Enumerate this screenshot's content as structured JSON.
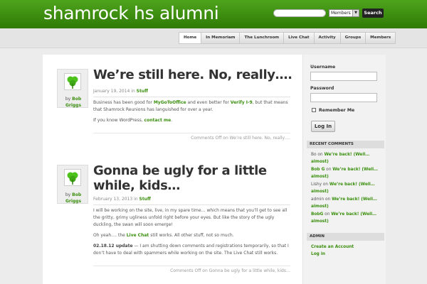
{
  "header": {
    "site_title": "shamrock hs alumni",
    "search_placeholder": "",
    "search_scope": "Members",
    "search_button": "Search"
  },
  "nav": {
    "items": [
      {
        "label": "Home",
        "active": true
      },
      {
        "label": "In Memoriam",
        "active": false
      },
      {
        "label": "The Lunchroom",
        "active": false
      },
      {
        "label": "Live Chat",
        "active": false
      },
      {
        "label": "Activity",
        "active": false
      },
      {
        "label": "Groups",
        "active": false
      },
      {
        "label": "Members",
        "active": false
      }
    ]
  },
  "posts": [
    {
      "by": "by",
      "author": "Bob Griggs",
      "title": "We’re still here. No, really….",
      "date": "January 19, 2014 in",
      "category": "Stuff",
      "p1_a": "Business has been good for ",
      "p1_link1": "MyGoToOffice",
      "p1_b": " and even better for ",
      "p1_link2": "Verify I-9",
      "p1_c": ", but that means that Shamrock Reunions has languished for over a year.",
      "p2_a": "If you know WordPress, ",
      "p2_link": "contact me",
      "p2_b": ".",
      "footer": "Comments Off on We’re still here. No, really…."
    },
    {
      "by": "by",
      "author": "Bob Griggs",
      "title": "Gonna be ugly for a little while, kids…",
      "date": "February 13, 2013 in",
      "category": "Stuff",
      "p1": "I will be working on the site, live, in my spare time… which means that you’ll get to see all the gritty, grimy ugliness unfold right before your eyes. But like the story of the ugly duckling, the swan will soon emerge!",
      "p2_a": "Oh yeah…. the ",
      "p2_link": "Live Chat",
      "p2_b": " still works. All other stuff, not so much.",
      "p3_bold": "02.18.12 update",
      "p3_rest": " — I am shutting down comments and registrations temporarily, so that I don’t have to deal with spammers while working on the site. The Live Chat still works.",
      "footer": "Comments Off on Gonna be ugly for a little while, kids…"
    }
  ],
  "login": {
    "username_label": "Username",
    "password_label": "Password",
    "remember_label": "Remember Me",
    "button": "Log In"
  },
  "recent_comments": {
    "heading": "RECENT COMMENTS",
    "items": [
      {
        "who": "Bo",
        "on": "on",
        "post": "We’re back! (Well… almost)"
      },
      {
        "who": "Bob G",
        "on": "on",
        "post": "We’re back! (Well… almost)"
      },
      {
        "who": "Lishy",
        "on": "on",
        "post": "We’re back! (Well… almost)"
      },
      {
        "who": "admin",
        "on": "on",
        "post": "We’re back! (Well… almost)"
      },
      {
        "who": "BobG",
        "on": "on",
        "post": "We’re back! (Well… almost)"
      }
    ]
  },
  "admin": {
    "heading": "ADMIN",
    "items": [
      "Create an Account",
      "Log in"
    ]
  }
}
